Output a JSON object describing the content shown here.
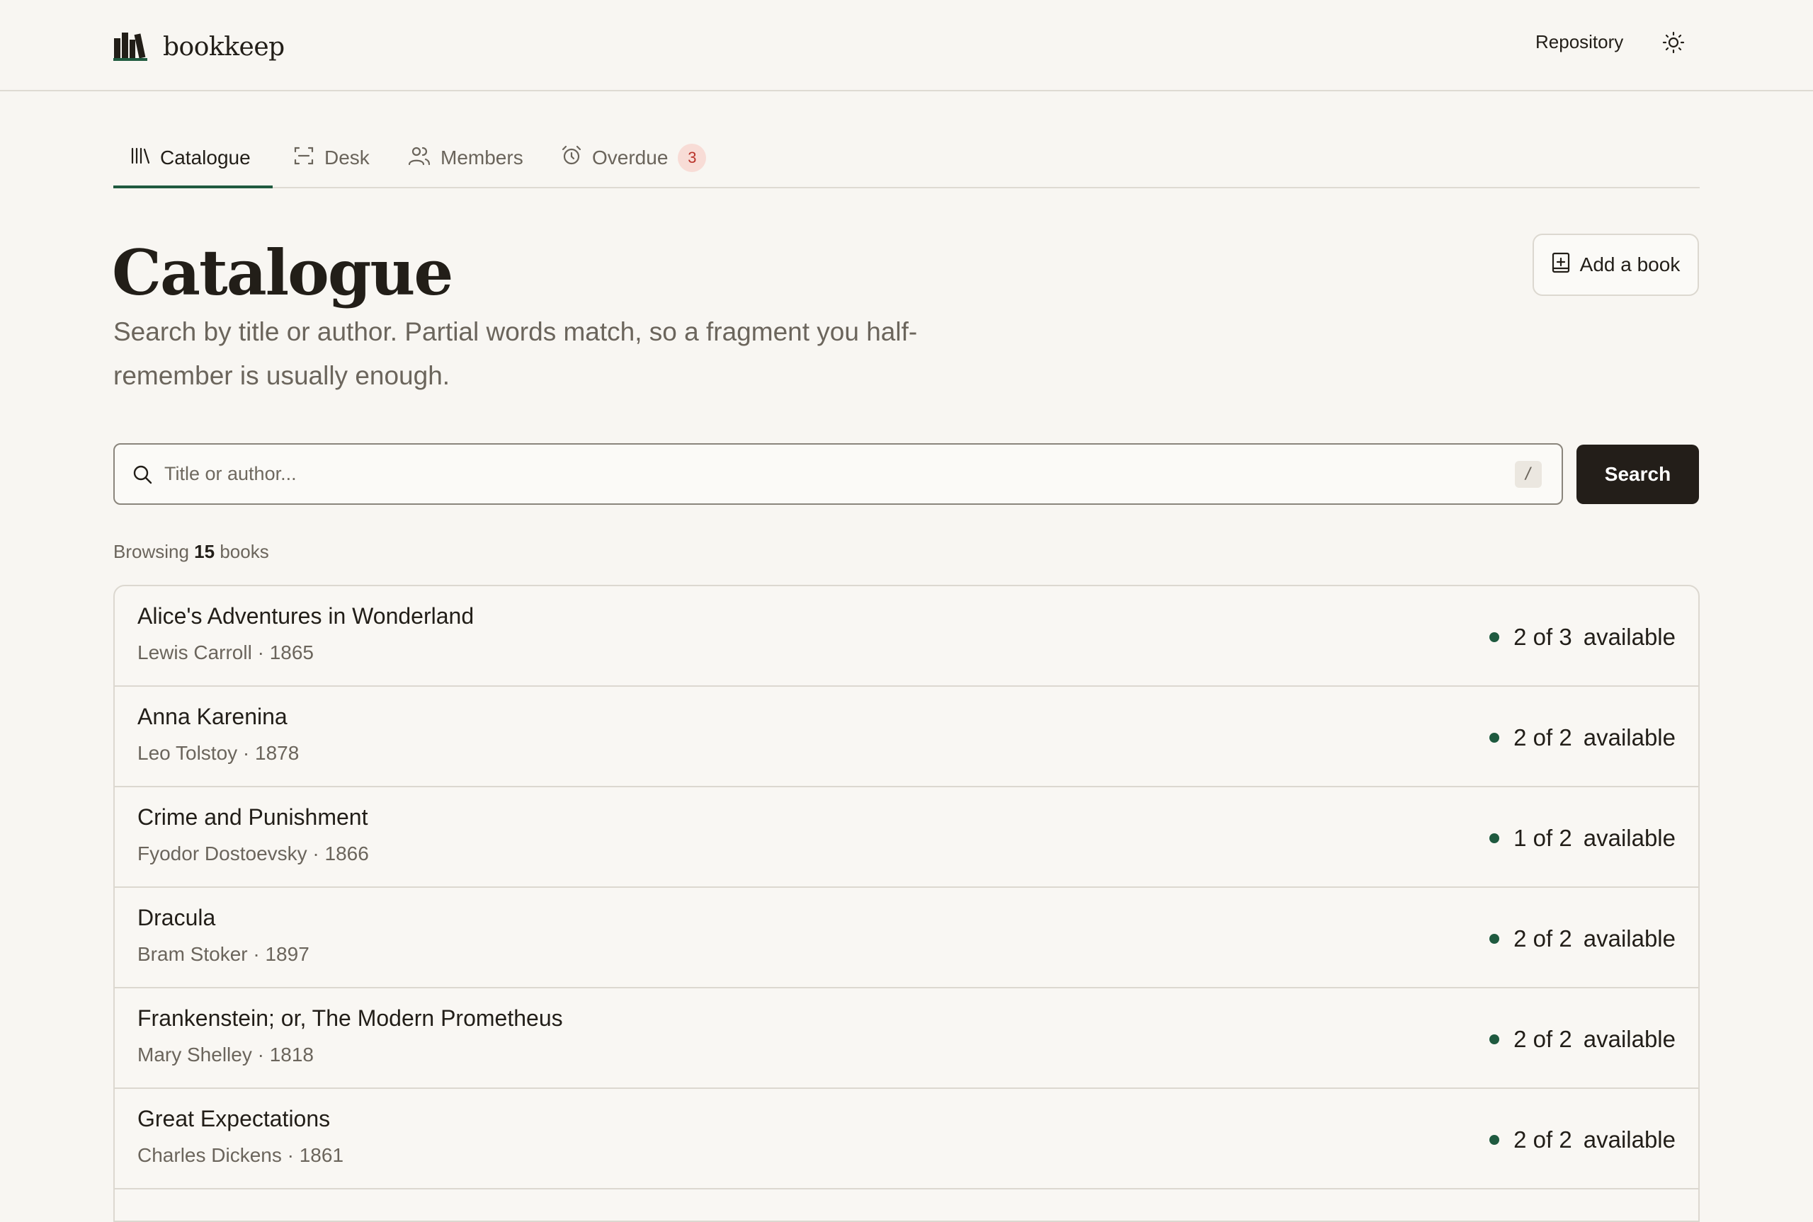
{
  "header": {
    "brand": "bookkeep",
    "repository_label": "Repository",
    "icons": {
      "logo": "books-logo-icon",
      "theme": "sun-icon"
    }
  },
  "tabs": [
    {
      "label": "Catalogue",
      "icon": "library-icon",
      "active": true
    },
    {
      "label": "Desk",
      "icon": "scan-icon",
      "active": false
    },
    {
      "label": "Members",
      "icon": "users-icon",
      "active": false
    },
    {
      "label": "Overdue",
      "icon": "alarm-clock-icon",
      "active": false,
      "badge": "3"
    }
  ],
  "page": {
    "title": "Catalogue",
    "description": "Search by title or author. Partial words match, so a fragment you half-remember is usually enough.",
    "add_button": "Add a book"
  },
  "search": {
    "placeholder": "Title or author...",
    "shortcut": "/",
    "button": "Search"
  },
  "browsing": {
    "prefix": "Browsing",
    "count": "15",
    "suffix": "books"
  },
  "books": [
    {
      "title": "Alice's Adventures in Wonderland",
      "meta": "Lewis Carroll · 1865",
      "count": "2 of 3",
      "status": "available"
    },
    {
      "title": "Anna Karenina",
      "meta": "Leo Tolstoy · 1878",
      "count": "2 of 2",
      "status": "available"
    },
    {
      "title": "Crime and Punishment",
      "meta": "Fyodor Dostoevsky · 1866",
      "count": "1 of 2",
      "status": "available"
    },
    {
      "title": "Dracula",
      "meta": "Bram Stoker · 1897",
      "count": "2 of 2",
      "status": "available"
    },
    {
      "title": "Frankenstein; or, The Modern Prometheus",
      "meta": "Mary Shelley · 1818",
      "count": "2 of 2",
      "status": "available"
    },
    {
      "title": "Great Expectations",
      "meta": "Charles Dickens · 1861",
      "count": "2 of 2",
      "status": "available"
    }
  ],
  "colors": {
    "accent": "#1f5a3f",
    "primary_button": "#231e19",
    "badge_bg": "#f8dcd6",
    "badge_text": "#b9332a",
    "background": "#f8f6f2"
  }
}
